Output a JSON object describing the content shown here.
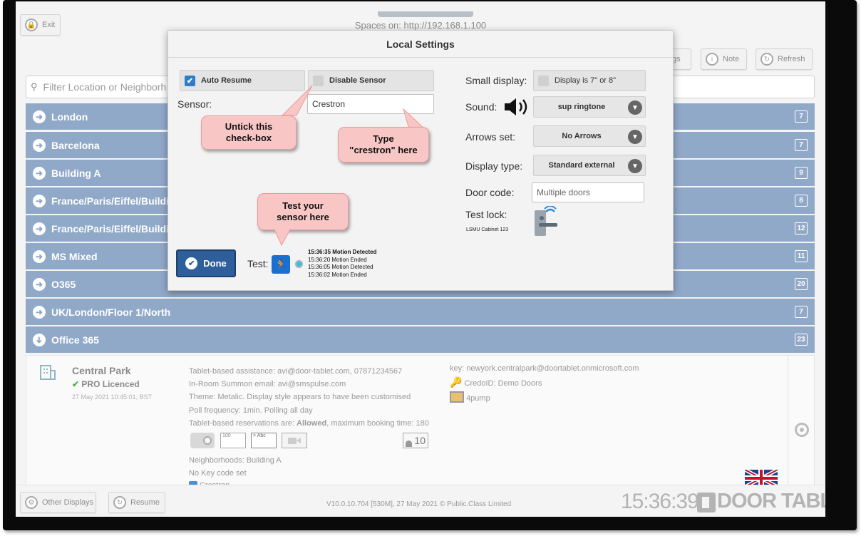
{
  "app": {
    "spaces_title": "Spaces on: http://192.168.1.100",
    "exit_label": "Exit",
    "settings_label": "gs",
    "note_label": "Note",
    "refresh_label": "Refresh",
    "filter_placeholder": "Filter Location or Neighborh"
  },
  "locations": [
    {
      "name": "London",
      "count": "7"
    },
    {
      "name": "Barcelona",
      "count": "7"
    },
    {
      "name": "Building A",
      "count": "9"
    },
    {
      "name": "France/Paris/Eiffel/Buildi",
      "count": "8"
    },
    {
      "name": "France/Paris/Eiffel/Buildi",
      "count": "12"
    },
    {
      "name": "MS Mixed",
      "count": "11"
    },
    {
      "name": "O365",
      "count": "20"
    },
    {
      "name": "UK/London/Floor 1/North",
      "count": "7"
    },
    {
      "name": "Office 365",
      "count": "23"
    }
  ],
  "detail": {
    "room_name": "Central Park",
    "licence": "PRO Licenced",
    "licence_date": "27 May 2021 10:45:01, BST",
    "lines": [
      "Tablet-based assistance: avi@door-tablet.com, 07871234567",
      "In-Room Summon email: avi@smspulse.com",
      "Theme: Metalic. Display style appears to have been customised",
      "Poll frequency: 1min. Polling all day"
    ],
    "reservations_prefix": "Tablet-based reservations are: ",
    "reservations_allowed": "Allowed",
    "reservations_suffix": ", maximum booking time: 180",
    "capacity": "10",
    "neighborhoods": "Neighborhoods: Building A",
    "keycode": "No Key code set",
    "crestron": "Crestron",
    "key": "key: newyork.centralpark@doortablet.onmicrosoft.com",
    "credo": "CredoID: Demo Doors",
    "pump": "4pump"
  },
  "bottom": {
    "other_displays": "Other Displays",
    "resume": "Resume",
    "version": "V10.0.10.704 [530M], 27 May 2021 © Public.Class Limited",
    "clock": "15:36:39",
    "brand": "DOOR TABLET"
  },
  "modal": {
    "title": "Local Settings",
    "auto_resume": "Auto Resume",
    "disable_sensor": "Disable Sensor",
    "sensor_label": "Sensor:",
    "sensor_value": "Crestron",
    "small_display_label": "Small display:",
    "small_display_option": "Display is 7\" or 8\"",
    "sound_label": "Sound:",
    "sound_value": "sup ringtone",
    "arrows_label": "Arrows set:",
    "arrows_value": "No Arrows",
    "display_type_label": "Display type:",
    "display_type_value": "Standard external",
    "door_code_label": "Door code:",
    "door_code_placeholder": "Multiple doors",
    "test_lock_label": "Test lock:",
    "test_lock_sub": "LSMU Cabinet 123",
    "done_label": "Done",
    "test_label": "Test:",
    "log": [
      "15:36:35 Motion Detected",
      "15:36:20 Motion Ended",
      "15:36:05 Motion Detected",
      "15:36:02 Motion Ended"
    ]
  },
  "callouts": {
    "untick": "Untick this check-box",
    "untick_l1": "Untick this",
    "untick_l2": "check-box",
    "type_l1": "Type",
    "type_l2": "\"crestron\" here",
    "test_l1": "Test your",
    "test_l2": "sensor here"
  },
  "colors": {
    "row_blue": "#91a9c9",
    "done_blue": "#2e5f9a",
    "callout_pink": "#f9c6c6",
    "checkbox_blue": "#2d7ec4"
  }
}
